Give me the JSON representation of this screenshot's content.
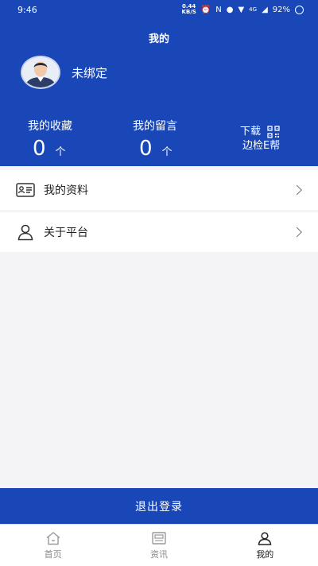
{
  "status_bar": {
    "time": "9:46",
    "net_speed_value": "0.44",
    "net_speed_unit": "KB/S",
    "network": "4G",
    "battery": "92%"
  },
  "header": {
    "title": "我的",
    "nickname": "未绑定",
    "favorites": {
      "label": "我的收藏",
      "count": "0",
      "unit": "个"
    },
    "messages": {
      "label": "我的留言",
      "count": "0",
      "unit": "个"
    },
    "download": {
      "line1": "下载",
      "line2": "边检E帮"
    }
  },
  "menu": [
    {
      "label": "我的资料",
      "icon": "id-card-icon"
    },
    {
      "label": "关于平台",
      "icon": "person-icon"
    }
  ],
  "logout_label": "退出登录",
  "tabs": [
    {
      "label": "首页",
      "icon": "home-icon"
    },
    {
      "label": "资讯",
      "icon": "news-icon"
    },
    {
      "label": "我的",
      "icon": "profile-icon",
      "active": true
    }
  ],
  "colors": {
    "primary": "#1a47b8",
    "background": "#f4f4f6"
  }
}
